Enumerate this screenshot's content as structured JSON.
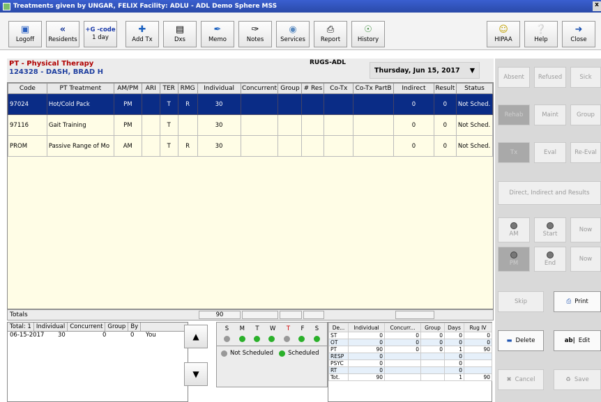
{
  "window": {
    "title": "Treatments given by UNGAR, FELIX    Facility: ADLU - ADL Demo Sphere MSS"
  },
  "toolbar": {
    "left": [
      {
        "label": "Logoff",
        "icon": "monitor-icon"
      },
      {
        "label": "Residents",
        "icon": "double-chevron-left-icon"
      },
      {
        "label": "+G -code",
        "sub": "1 day",
        "icon": "gcode-icon"
      },
      {
        "label": "Add Tx",
        "icon": "plus-icon"
      },
      {
        "label": "Dxs",
        "icon": "list-icon"
      },
      {
        "label": "Memo",
        "icon": "pen-icon"
      },
      {
        "label": "Notes",
        "icon": "quill-icon"
      },
      {
        "label": "Services",
        "icon": "services-icon"
      },
      {
        "label": "Report",
        "icon": "printer-icon"
      },
      {
        "label": "History",
        "icon": "history-icon"
      }
    ],
    "right": [
      {
        "label": "HIPAA",
        "icon": "hipaa-icon"
      },
      {
        "label": "Help",
        "icon": "help-icon"
      },
      {
        "label": "Close",
        "icon": "exit-icon"
      }
    ]
  },
  "header": {
    "discipline": "PT - Physical Therapy",
    "resident": "124328 - DASH, BRAD H",
    "rugs": "RUGS-ADL",
    "date": "Thursday, Jun 15, 2017"
  },
  "grid": {
    "columns": [
      "Code",
      "PT Treatment",
      "AM/PM",
      "ARI",
      "TER",
      "RMG",
      "Individual",
      "Concurrent",
      "Group",
      "# Res",
      "Co-Tx",
      "Co-Tx PartB",
      "Indirect",
      "Result",
      "Status"
    ],
    "rows": [
      [
        "97024",
        "Hot/Cold Pack",
        "PM",
        "",
        "T",
        "R",
        "30",
        "",
        "",
        "",
        "",
        "",
        "0",
        "0",
        "Not Sched."
      ],
      [
        "97116",
        "Gait Training",
        "PM",
        "",
        "T",
        "",
        "30",
        "",
        "",
        "",
        "",
        "",
        "0",
        "0",
        "Not Sched."
      ],
      [
        "PROM",
        "Passive Range of Mo",
        "AM",
        "",
        "T",
        "R",
        "30",
        "",
        "",
        "",
        "",
        "",
        "0",
        "0",
        "Not Sched."
      ]
    ]
  },
  "totals": {
    "label": "Totals",
    "individual": "90"
  },
  "lower": {
    "columns": [
      "Total: 1",
      "Individual",
      "Concurrent",
      "Group",
      "By"
    ],
    "row": [
      "06-15-2017",
      "30",
      "0",
      "0",
      "You"
    ]
  },
  "week": {
    "days": [
      "S",
      "M",
      "T",
      "W",
      "T",
      "F",
      "S"
    ],
    "legend_not": "Not Scheduled",
    "legend_sched": "Scheduled"
  },
  "discipline_summary": {
    "columns": [
      "De...",
      "Individual",
      "Concurr...",
      "Group",
      "Days",
      "Rug IV"
    ],
    "rows": [
      [
        "ST",
        "0",
        "0",
        "0",
        "0",
        "0"
      ],
      [
        "OT",
        "0",
        "0",
        "0",
        "0",
        "0"
      ],
      [
        "PT",
        "90",
        "0",
        "0",
        "1",
        "90"
      ],
      [
        "RESP",
        "0",
        "",
        "",
        "0",
        ""
      ],
      [
        "PSYC",
        "0",
        "",
        "",
        "0",
        ""
      ],
      [
        "RT",
        "0",
        "",
        "",
        "0",
        ""
      ]
    ],
    "total": [
      "Tot.",
      "90",
      "",
      "",
      "1",
      "90"
    ]
  },
  "side": {
    "absent": "Absent",
    "refused": "Refused",
    "sick": "Sick",
    "rehab": "Rehab",
    "maint": "Maint",
    "group": "Group",
    "tx": "Tx",
    "eval": "Eval",
    "reeval": "Re-Eval",
    "direct": "Direct, Indirect and Results",
    "am": "AM",
    "start": "Start",
    "now1": "Now",
    "pm": "PM",
    "end": "End",
    "now2": "Now",
    "skip": "Skip",
    "print": "Print",
    "delete": "Delete",
    "edit": "Edit",
    "cancel": "Cancel",
    "save": "Save"
  }
}
